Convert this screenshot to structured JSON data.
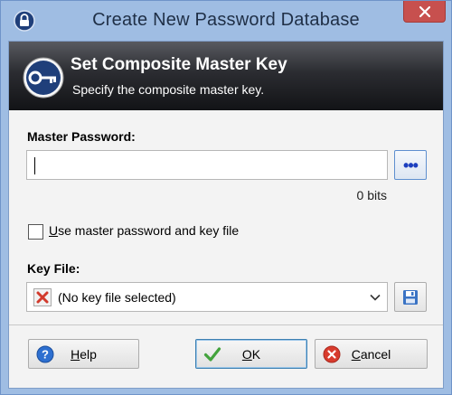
{
  "window": {
    "title": "Create New Password Database",
    "close_symbol": "✕"
  },
  "banner": {
    "title": "Set Composite Master Key",
    "subtitle": "Specify the composite master key."
  },
  "master_password": {
    "label": "Master Password:",
    "value": "",
    "reveal_button_label": "•••",
    "strength": "0 bits"
  },
  "key_file_option": {
    "checked": false,
    "label_mnemonic": "U",
    "label_rest": "se master password and key file"
  },
  "key_file": {
    "label": "Key File:",
    "selected": "(No key file selected)"
  },
  "buttons": {
    "help_mnemonic": "H",
    "help_rest": "elp",
    "ok_mnemonic": "O",
    "ok_rest": "K",
    "cancel_mnemonic": "C",
    "cancel_rest": "ancel"
  },
  "icons": {
    "app": "lock-icon",
    "banner": "key-icon",
    "dots": "ellipsis-icon",
    "keyfile": "remove-x-icon",
    "save": "floppy-disk-icon",
    "help": "help-icon",
    "ok": "checkmark-icon",
    "cancel": "cancel-icon"
  },
  "colors": {
    "title_bar": "#9fbde3",
    "close_button": "#c7504e",
    "banner_dark": "#121316",
    "dots_blue": "#1d3fbf"
  }
}
